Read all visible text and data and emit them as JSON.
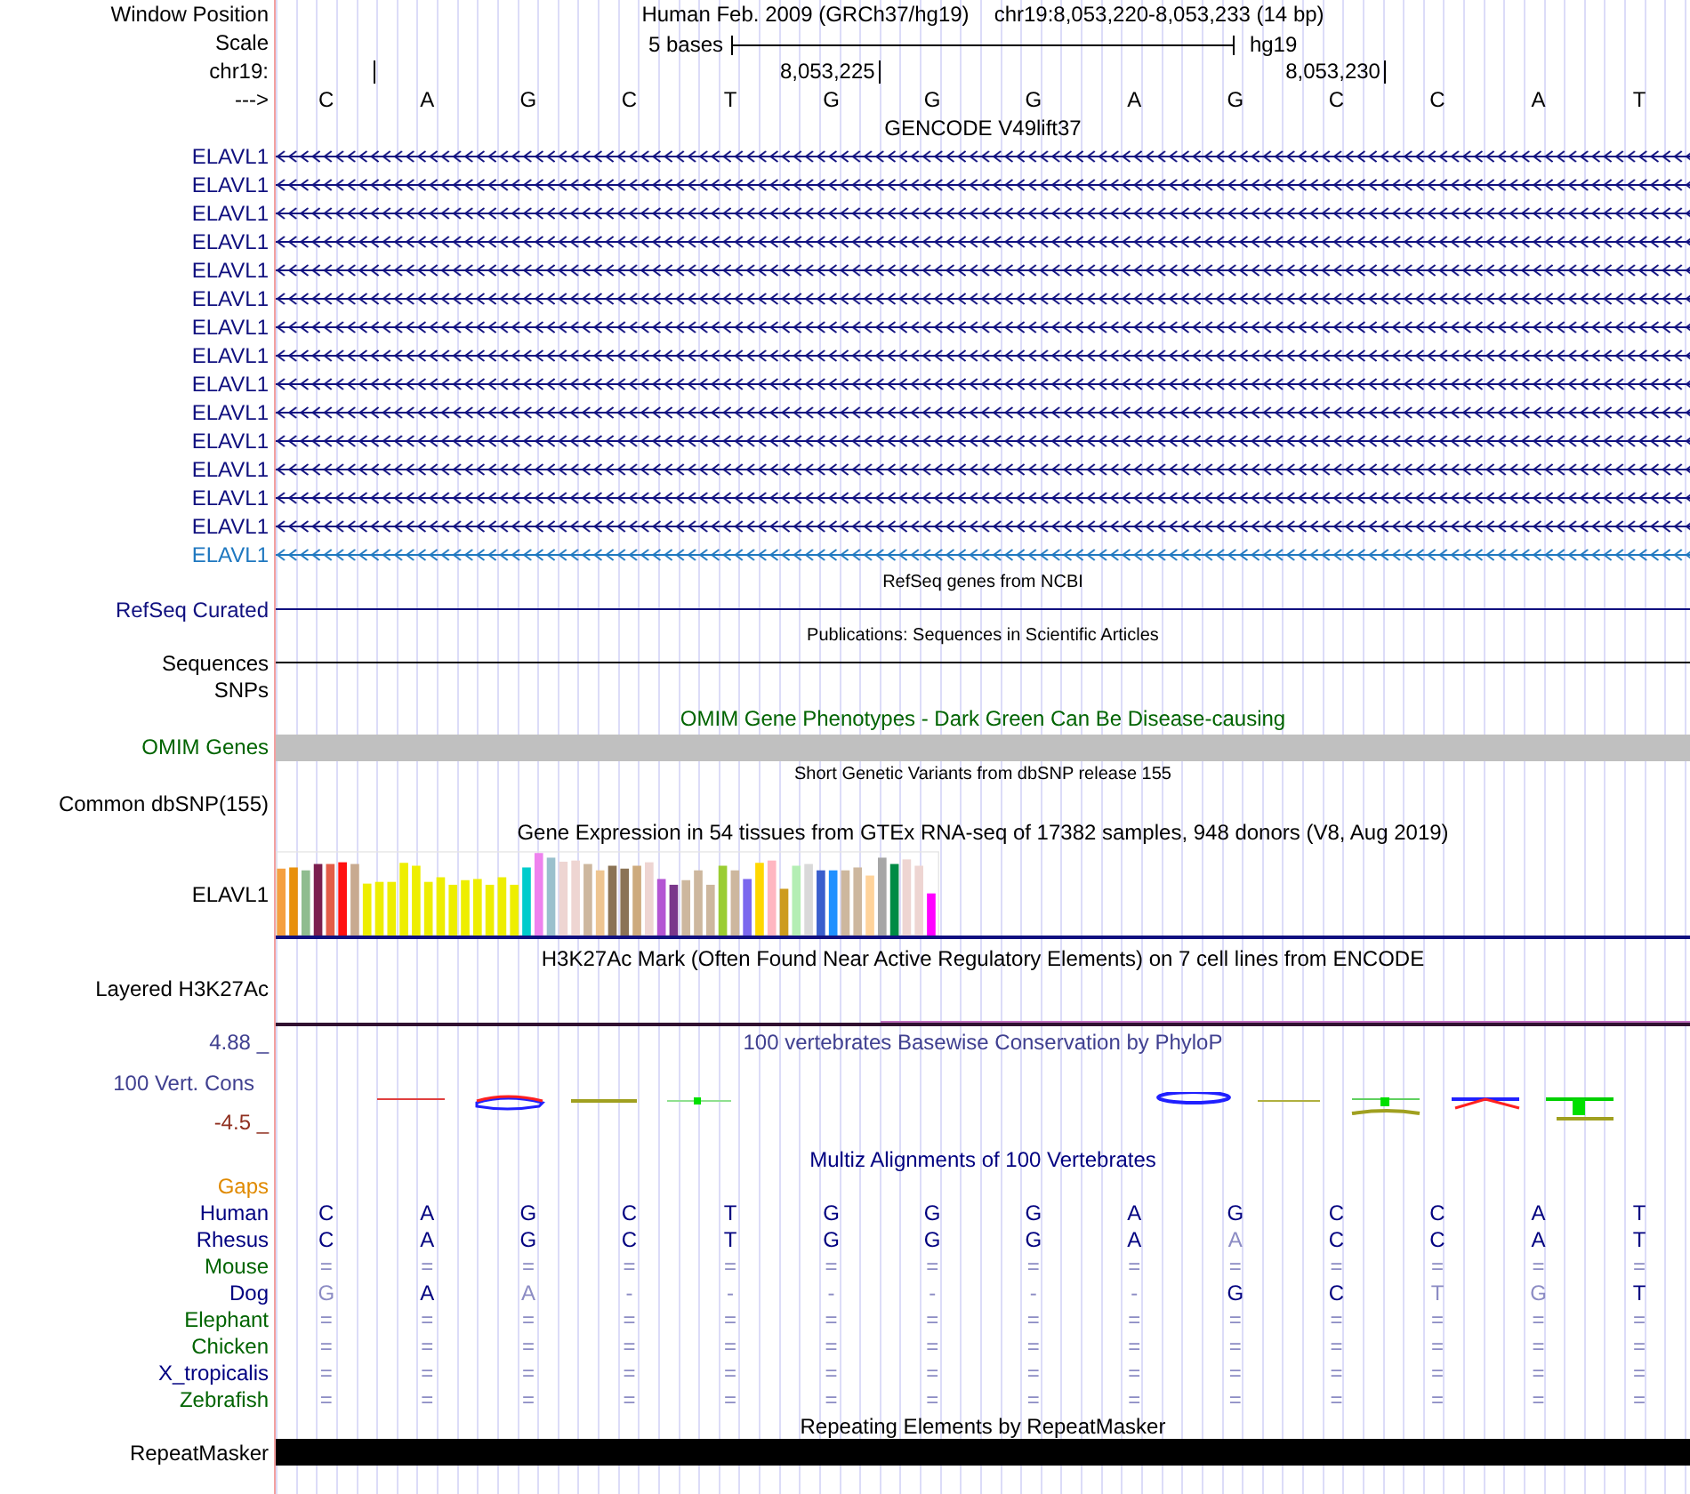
{
  "header": {
    "label": "Window Position",
    "assembly": "Human Feb. 2009 (GRCh37/hg19)",
    "position": "chr19:8,053,220-8,053,233 (14 bp)"
  },
  "scale": {
    "label": "Scale",
    "span": "5 bases",
    "assembly": "hg19"
  },
  "ruler": {
    "label": "chr19:",
    "cells": [
      {
        "tick": true
      },
      {
        "tick": false
      },
      {
        "tick": false
      },
      {
        "tick": false
      },
      {
        "tick": false
      },
      {
        "tick": true,
        "label": "8,053,225"
      },
      {
        "tick": false
      },
      {
        "tick": false
      },
      {
        "tick": false
      },
      {
        "tick": false
      },
      {
        "tick": true,
        "label": "8,053,230"
      },
      {
        "tick": false
      },
      {
        "tick": false
      },
      {
        "tick": false
      }
    ]
  },
  "sequence": {
    "label": "--->",
    "bases": [
      "C",
      "A",
      "G",
      "C",
      "T",
      "G",
      "G",
      "G",
      "A",
      "G",
      "C",
      "C",
      "A",
      "T"
    ]
  },
  "gencode": {
    "title": "GENCODE V49lift37",
    "genes": [
      {
        "name": "ELAVL1",
        "color": "#10107f"
      },
      {
        "name": "ELAVL1",
        "color": "#10107f"
      },
      {
        "name": "ELAVL1",
        "color": "#10107f"
      },
      {
        "name": "ELAVL1",
        "color": "#10107f"
      },
      {
        "name": "ELAVL1",
        "color": "#10107f"
      },
      {
        "name": "ELAVL1",
        "color": "#10107f"
      },
      {
        "name": "ELAVL1",
        "color": "#10107f"
      },
      {
        "name": "ELAVL1",
        "color": "#10107f"
      },
      {
        "name": "ELAVL1",
        "color": "#10107f"
      },
      {
        "name": "ELAVL1",
        "color": "#10107f"
      },
      {
        "name": "ELAVL1",
        "color": "#10107f"
      },
      {
        "name": "ELAVL1",
        "color": "#10107f"
      },
      {
        "name": "ELAVL1",
        "color": "#10107f"
      },
      {
        "name": "ELAVL1",
        "color": "#10107f"
      },
      {
        "name": "ELAVL1",
        "color": "#1f78c0"
      }
    ]
  },
  "refseq": {
    "title": "RefSeq genes from NCBI",
    "label": "RefSeq Curated"
  },
  "publications": {
    "title": "Publications: Sequences in Scientific Articles",
    "label": "Sequences"
  },
  "snps": {
    "label": "SNPs"
  },
  "omim": {
    "title": "OMIM Gene Phenotypes - Dark Green Can Be Disease-causing",
    "label": "OMIM Genes"
  },
  "dbsnp": {
    "title": "Short Genetic Variants from dbSNP release 155",
    "label": "Common dbSNP(155)"
  },
  "gtex": {
    "title": "Gene Expression in 54 tissues from GTEx RNA-seq of 17382 samples, 948 donors (V8, Aug 2019)",
    "label": "ELAVL1"
  },
  "h3k27ac": {
    "title": "H3K27Ac Mark (Often Found Near Active Regulatory Elements) on 7 cell lines from ENCODE",
    "label": "Layered H3K27Ac"
  },
  "conservation": {
    "title": "100 vertebrates Basewise Conservation by PhyloP",
    "label": "100 Vert. Cons",
    "max": "4.88 _",
    "min": "-4.5 _"
  },
  "multiz": {
    "title": "Multiz Alignments of 100 Vertebrates",
    "gaps_label": "Gaps",
    "species": [
      {
        "name": "Human",
        "color": "#000080",
        "bases": [
          {
            "b": "C",
            "dim": false
          },
          {
            "b": "A",
            "dim": false
          },
          {
            "b": "G",
            "dim": false
          },
          {
            "b": "C",
            "dim": false
          },
          {
            "b": "T",
            "dim": false
          },
          {
            "b": "G",
            "dim": false
          },
          {
            "b": "G",
            "dim": false
          },
          {
            "b": "G",
            "dim": false
          },
          {
            "b": "A",
            "dim": false
          },
          {
            "b": "G",
            "dim": false
          },
          {
            "b": "C",
            "dim": false
          },
          {
            "b": "C",
            "dim": false
          },
          {
            "b": "A",
            "dim": false
          },
          {
            "b": "T",
            "dim": false
          }
        ]
      },
      {
        "name": "Rhesus",
        "color": "#000080",
        "bases": [
          {
            "b": "C",
            "dim": false
          },
          {
            "b": "A",
            "dim": false
          },
          {
            "b": "G",
            "dim": false
          },
          {
            "b": "C",
            "dim": false
          },
          {
            "b": "T",
            "dim": false
          },
          {
            "b": "G",
            "dim": false
          },
          {
            "b": "G",
            "dim": false
          },
          {
            "b": "G",
            "dim": false
          },
          {
            "b": "A",
            "dim": false
          },
          {
            "b": "A",
            "dim": true
          },
          {
            "b": "C",
            "dim": false
          },
          {
            "b": "C",
            "dim": false
          },
          {
            "b": "A",
            "dim": false
          },
          {
            "b": "T",
            "dim": false
          }
        ]
      },
      {
        "name": "Mouse",
        "color": "#006400",
        "bases": [
          {
            "b": "=",
            "dim": true
          },
          {
            "b": "=",
            "dim": true
          },
          {
            "b": "=",
            "dim": true
          },
          {
            "b": "=",
            "dim": true
          },
          {
            "b": "=",
            "dim": true
          },
          {
            "b": "=",
            "dim": true
          },
          {
            "b": "=",
            "dim": true
          },
          {
            "b": "=",
            "dim": true
          },
          {
            "b": "=",
            "dim": true
          },
          {
            "b": "=",
            "dim": true
          },
          {
            "b": "=",
            "dim": true
          },
          {
            "b": "=",
            "dim": true
          },
          {
            "b": "=",
            "dim": true
          },
          {
            "b": "=",
            "dim": true
          }
        ]
      },
      {
        "name": "Dog",
        "color": "#000080",
        "bases": [
          {
            "b": "G",
            "dim": true
          },
          {
            "b": "A",
            "dim": false
          },
          {
            "b": "A",
            "dim": true
          },
          {
            "b": "-",
            "dim": true
          },
          {
            "b": "-",
            "dim": true
          },
          {
            "b": "-",
            "dim": true
          },
          {
            "b": "-",
            "dim": true
          },
          {
            "b": "-",
            "dim": true
          },
          {
            "b": "-",
            "dim": true
          },
          {
            "b": "G",
            "dim": false
          },
          {
            "b": "C",
            "dim": false
          },
          {
            "b": "T",
            "dim": true
          },
          {
            "b": "G",
            "dim": true
          },
          {
            "b": "T",
            "dim": false
          }
        ]
      },
      {
        "name": "Elephant",
        "color": "#006400",
        "bases": [
          {
            "b": "=",
            "dim": true
          },
          {
            "b": "=",
            "dim": true
          },
          {
            "b": "=",
            "dim": true
          },
          {
            "b": "=",
            "dim": true
          },
          {
            "b": "=",
            "dim": true
          },
          {
            "b": "=",
            "dim": true
          },
          {
            "b": "=",
            "dim": true
          },
          {
            "b": "=",
            "dim": true
          },
          {
            "b": "=",
            "dim": true
          },
          {
            "b": "=",
            "dim": true
          },
          {
            "b": "=",
            "dim": true
          },
          {
            "b": "=",
            "dim": true
          },
          {
            "b": "=",
            "dim": true
          },
          {
            "b": "=",
            "dim": true
          }
        ]
      },
      {
        "name": "Chicken",
        "color": "#006400",
        "bases": [
          {
            "b": "=",
            "dim": true
          },
          {
            "b": "=",
            "dim": true
          },
          {
            "b": "=",
            "dim": true
          },
          {
            "b": "=",
            "dim": true
          },
          {
            "b": "=",
            "dim": true
          },
          {
            "b": "=",
            "dim": true
          },
          {
            "b": "=",
            "dim": true
          },
          {
            "b": "=",
            "dim": true
          },
          {
            "b": "=",
            "dim": true
          },
          {
            "b": "=",
            "dim": true
          },
          {
            "b": "=",
            "dim": true
          },
          {
            "b": "=",
            "dim": true
          },
          {
            "b": "=",
            "dim": true
          },
          {
            "b": "=",
            "dim": true
          }
        ]
      },
      {
        "name": "X_tropicalis",
        "color": "#000080",
        "bases": [
          {
            "b": "=",
            "dim": true
          },
          {
            "b": "=",
            "dim": true
          },
          {
            "b": "=",
            "dim": true
          },
          {
            "b": "=",
            "dim": true
          },
          {
            "b": "=",
            "dim": true
          },
          {
            "b": "=",
            "dim": true
          },
          {
            "b": "=",
            "dim": true
          },
          {
            "b": "=",
            "dim": true
          },
          {
            "b": "=",
            "dim": true
          },
          {
            "b": "=",
            "dim": true
          },
          {
            "b": "=",
            "dim": true
          },
          {
            "b": "=",
            "dim": true
          },
          {
            "b": "=",
            "dim": true
          },
          {
            "b": "=",
            "dim": true
          }
        ]
      },
      {
        "name": "Zebrafish",
        "color": "#006400",
        "bases": [
          {
            "b": "=",
            "dim": true
          },
          {
            "b": "=",
            "dim": true
          },
          {
            "b": "=",
            "dim": true
          },
          {
            "b": "=",
            "dim": true
          },
          {
            "b": "=",
            "dim": true
          },
          {
            "b": "=",
            "dim": true
          },
          {
            "b": "=",
            "dim": true
          },
          {
            "b": "=",
            "dim": true
          },
          {
            "b": "=",
            "dim": true
          },
          {
            "b": "=",
            "dim": true
          },
          {
            "b": "=",
            "dim": true
          },
          {
            "b": "=",
            "dim": true
          },
          {
            "b": "=",
            "dim": true
          },
          {
            "b": "=",
            "dim": true
          }
        ]
      }
    ]
  },
  "repeatmasker": {
    "title": "Repeating Elements by RepeatMasker",
    "label": "RepeatMasker"
  }
}
